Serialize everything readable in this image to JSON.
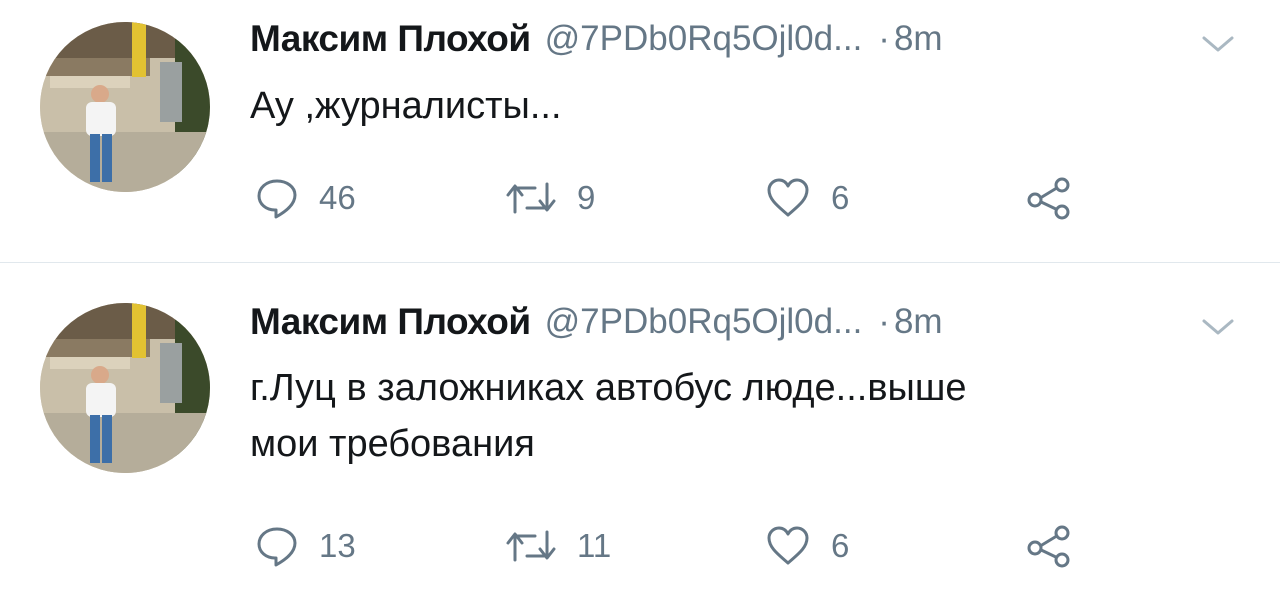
{
  "colors": {
    "text": "#14171a",
    "muted": "#657786",
    "divider": "#e1e8ed",
    "background": "#ffffff"
  },
  "icons": {
    "reply": "reply-bubble-icon",
    "retweet": "retweet-arrows-icon",
    "like": "heart-outline-icon",
    "share": "share-nodes-icon",
    "menu": "chevron-down-icon"
  },
  "tweets": [
    {
      "author_name": "Максим Плохой",
      "handle": "@7PDb0Rq5Ojl0d...",
      "separator": "·",
      "time": "8m",
      "text_lines": [
        "Ау ,журналисты..."
      ],
      "reply_count": "46",
      "retweet_count": "9",
      "like_count": "6"
    },
    {
      "author_name": "Максим Плохой",
      "handle": "@7PDb0Rq5Ojl0d...",
      "separator": "·",
      "time": "8m",
      "text_lines": [
        "г.Луц в заложниках автобус люде...выше",
        "мои требования"
      ],
      "reply_count": "13",
      "retweet_count": "11",
      "like_count": "6"
    }
  ]
}
